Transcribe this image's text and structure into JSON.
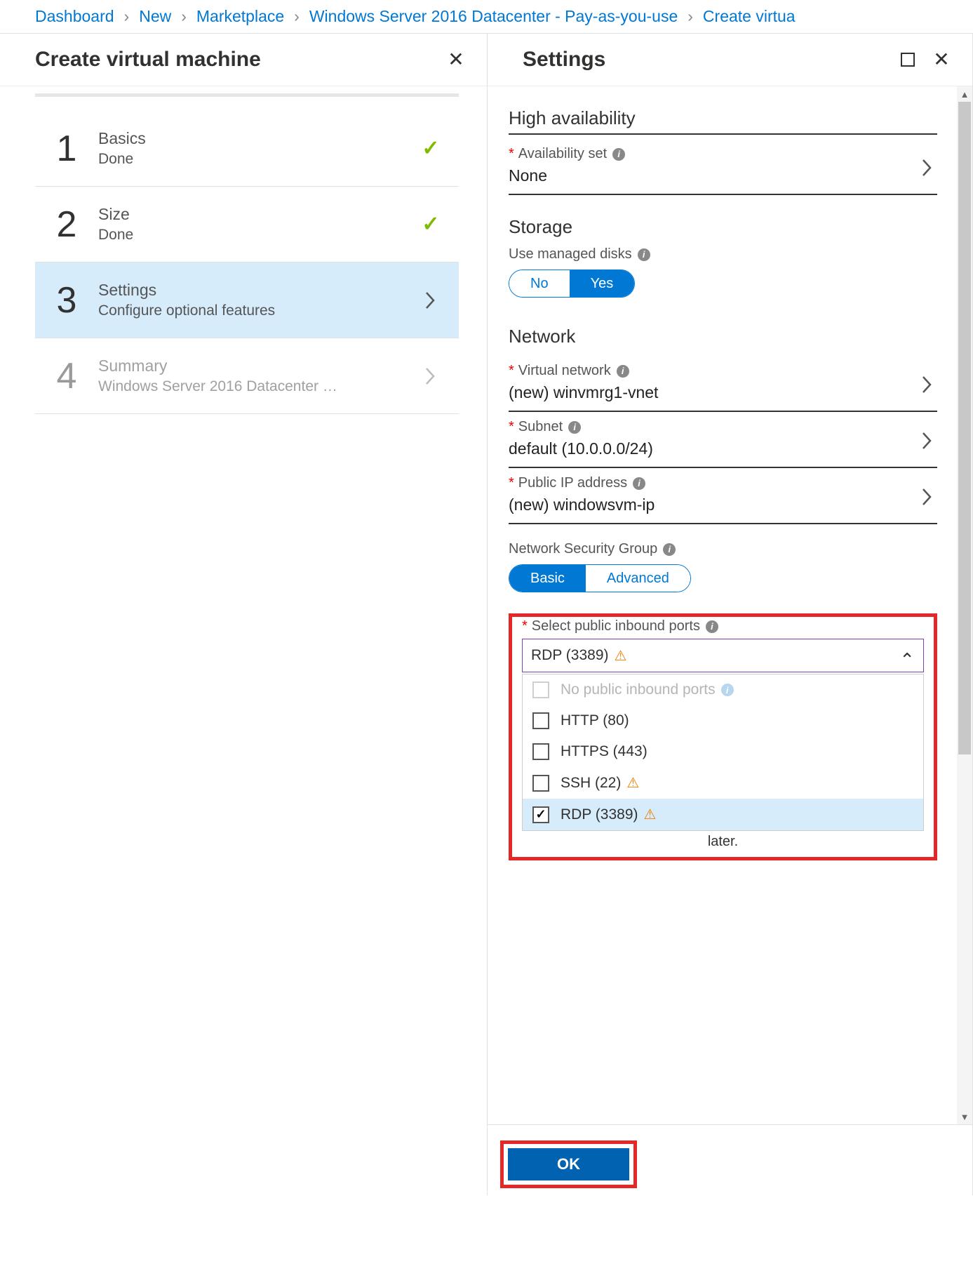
{
  "breadcrumb": {
    "items": [
      "Dashboard",
      "New",
      "Marketplace",
      "Windows Server 2016 Datacenter - Pay-as-you-use",
      "Create virtua"
    ]
  },
  "leftBlade": {
    "title": "Create virtual machine",
    "steps": [
      {
        "num": "1",
        "title": "Basics",
        "sub": "Done",
        "state": "done"
      },
      {
        "num": "2",
        "title": "Size",
        "sub": "Done",
        "state": "done"
      },
      {
        "num": "3",
        "title": "Settings",
        "sub": "Configure optional features",
        "state": "active"
      },
      {
        "num": "4",
        "title": "Summary",
        "sub": "Windows Server 2016 Datacenter …",
        "state": "disabled"
      }
    ]
  },
  "rightBlade": {
    "title": "Settings",
    "sections": {
      "ha": {
        "title": "High availability",
        "availability": {
          "label": "Availability set",
          "value": "None"
        }
      },
      "storage": {
        "title": "Storage",
        "managed": {
          "label": "Use managed disks",
          "options": [
            "No",
            "Yes"
          ],
          "selected": 1
        }
      },
      "network": {
        "title": "Network",
        "vnet": {
          "label": "Virtual network",
          "value": "(new) winvmrg1-vnet"
        },
        "subnet": {
          "label": "Subnet",
          "value": "default (10.0.0.0/24)"
        },
        "pip": {
          "label": "Public IP address",
          "value": "(new) windowsvm-ip"
        },
        "nsg": {
          "label": "Network Security Group",
          "options": [
            "Basic",
            "Advanced"
          ],
          "selected": 0
        },
        "ports": {
          "label": "Select public inbound ports",
          "selectedText": "RDP (3389)",
          "options": [
            {
              "label": "No public inbound ports",
              "disabled": true,
              "info": true
            },
            {
              "label": "HTTP (80)"
            },
            {
              "label": "HTTPS (443)"
            },
            {
              "label": "SSH (22)",
              "warn": true
            },
            {
              "label": "RDP (3389)",
              "warn": true,
              "checked": true,
              "hover": true
            }
          ],
          "trailing": "later."
        }
      }
    },
    "ok": "OK"
  }
}
